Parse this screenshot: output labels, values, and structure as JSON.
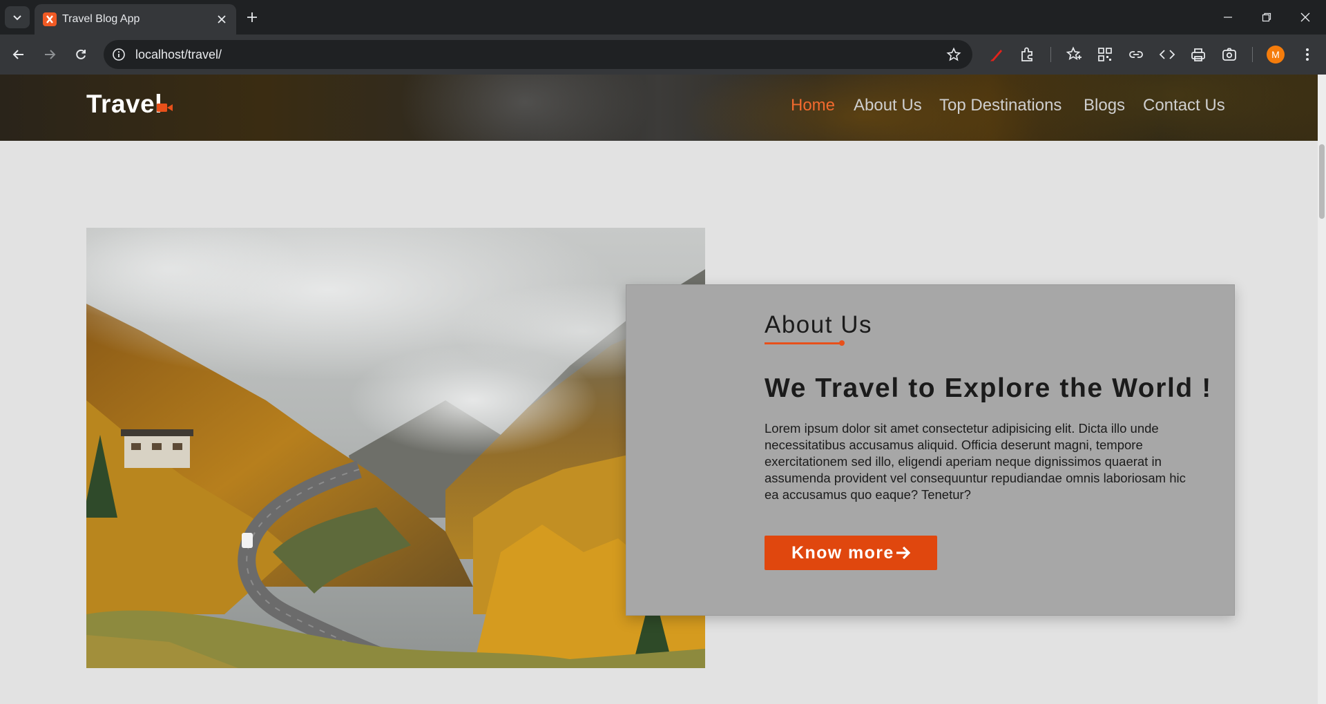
{
  "browser": {
    "tab_title": "Travel Blog App",
    "url": "localhost/travel/",
    "profile_initial": "M"
  },
  "site": {
    "logo": "Travel",
    "nav": [
      {
        "label": "Home",
        "active": true
      },
      {
        "label": "About Us",
        "active": false
      },
      {
        "label": "Top Destinations",
        "active": false
      },
      {
        "label": "Blogs",
        "active": false
      },
      {
        "label": "Contact Us",
        "active": false
      }
    ]
  },
  "about": {
    "label": "About Us",
    "heading": "We Travel to Explore the World !",
    "body": "Lorem ipsum dolor sit amet consectetur adipisicing elit. Dicta illo unde necessitatibus accusamus aliquid. Officia deserunt magni, tempore exercitationem sed illo, eligendi aperiam neque dignissimos quaerat in assumenda provident vel consequuntur repudiandae omnis laboriosam hic ea accusamus quo eaque? Tenetur?",
    "button": "Know more"
  },
  "colors": {
    "accent": "#e0470e",
    "nav_active": "#f26a2e",
    "card_bg": "#a7a7a7",
    "page_bg": "#e2e2e2"
  }
}
